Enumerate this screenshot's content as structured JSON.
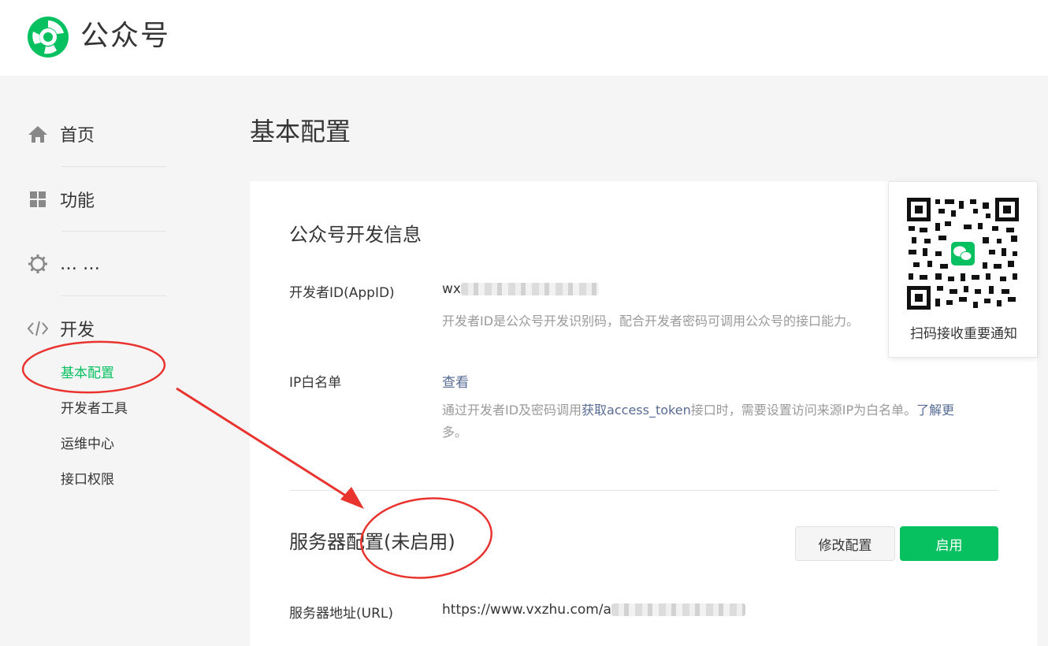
{
  "header": {
    "brand": "公众号"
  },
  "sidebar": {
    "items": [
      {
        "label": "首页",
        "icon": "home-icon"
      },
      {
        "label": "功能",
        "icon": "grid-icon"
      },
      {
        "label": "… …",
        "icon": "gear-icon"
      },
      {
        "label": "开发",
        "icon": "code-icon"
      }
    ],
    "sub_items": [
      {
        "label": "基本配置",
        "active": true
      },
      {
        "label": "开发者工具",
        "active": false
      },
      {
        "label": "运维中心",
        "active": false
      },
      {
        "label": "接口权限",
        "active": false
      }
    ]
  },
  "main": {
    "page_title": "基本配置",
    "dev_info": {
      "title": "公众号开发信息",
      "appid_label": "开发者ID(AppID)",
      "appid_value_prefix": "wx",
      "appid_desc": "开发者ID是公众号开发识别码，配合开发者密码可调用公众号的接口能力。",
      "ip_label": "IP白名单",
      "ip_view_link": "查看",
      "ip_desc_1": "通过开发者ID及密码调用",
      "ip_desc_link": "获取access_token",
      "ip_desc_2": "接口时，需要设置访问来源IP为白名单。",
      "ip_learn_more": "了解更",
      "ip_learn_more_2": "多",
      "ip_desc_end": "。"
    },
    "server_config": {
      "title": "服务器配置(未启用)",
      "modify_button": "修改配置",
      "enable_button": "启用",
      "url_label": "服务器地址(URL)",
      "url_value_prefix": "https://www.vxzhu.com/a"
    }
  },
  "qr_card": {
    "caption": "扫码接收重要通知"
  },
  "colors": {
    "accent": "#07c160",
    "link": "#576b95",
    "annotation": "#e8332f"
  }
}
